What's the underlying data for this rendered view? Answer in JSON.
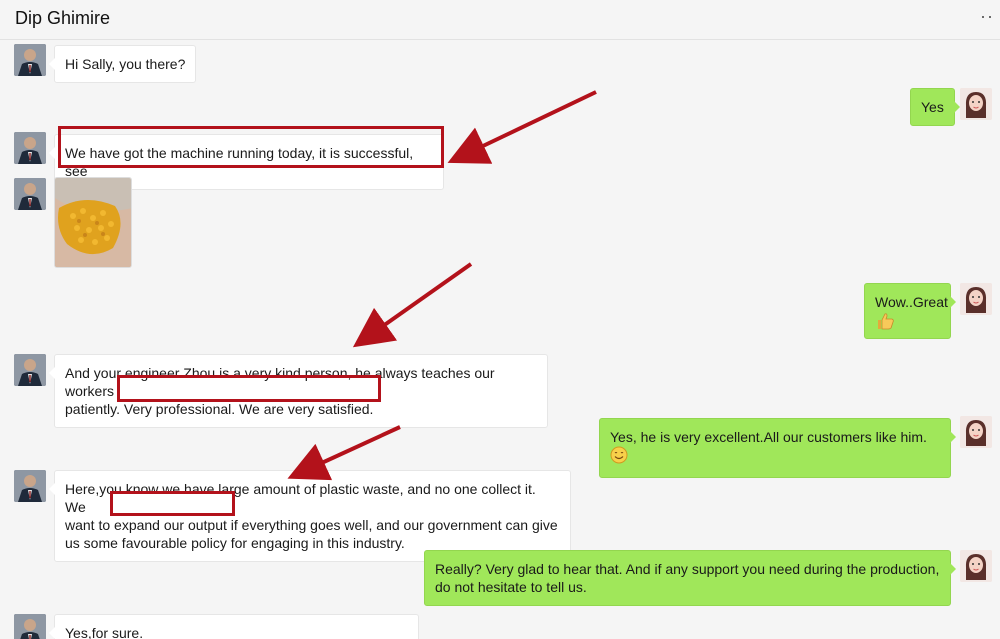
{
  "header": {
    "title": "Dip Ghimire",
    "more": "··"
  },
  "messages": {
    "m1": "Hi Sally, you there?",
    "m2": "Yes",
    "m3": "We have got the machine running today, it is successful, see",
    "m4_line1": "Wow..Great",
    "m5_line1": "And your engineer Zhou is a very kind person, he always teaches our workers",
    "m5_line2": "patiently. Very professional. We are very satisfied.",
    "m6": "Yes, he is very excellent.All our customers like him.",
    "m7_line1": "Here,you know we have large amount of plastic waste, and no one collect it. We",
    "m7_line2": "want to expand our output if everything goes well, and our government can give",
    "m7_line3": "us some favourable policy for engaging in this industry.",
    "m8_line1": "Really? Very glad to hear that. And if any support you need during the production,",
    "m8_line2": "do not hesitate to tell us.",
    "m9": "Yes,for sure."
  },
  "icons": {
    "thumbs_up": "thumbs-up-emoji",
    "smile": "smile-emoji",
    "avatar_left": "man-in-suit-avatar",
    "avatar_right": "woman-avatar"
  },
  "colors": {
    "outgoing_bubble": "#a0e75a",
    "incoming_bubble": "#ffffff",
    "annotation_red": "#b3121b"
  }
}
